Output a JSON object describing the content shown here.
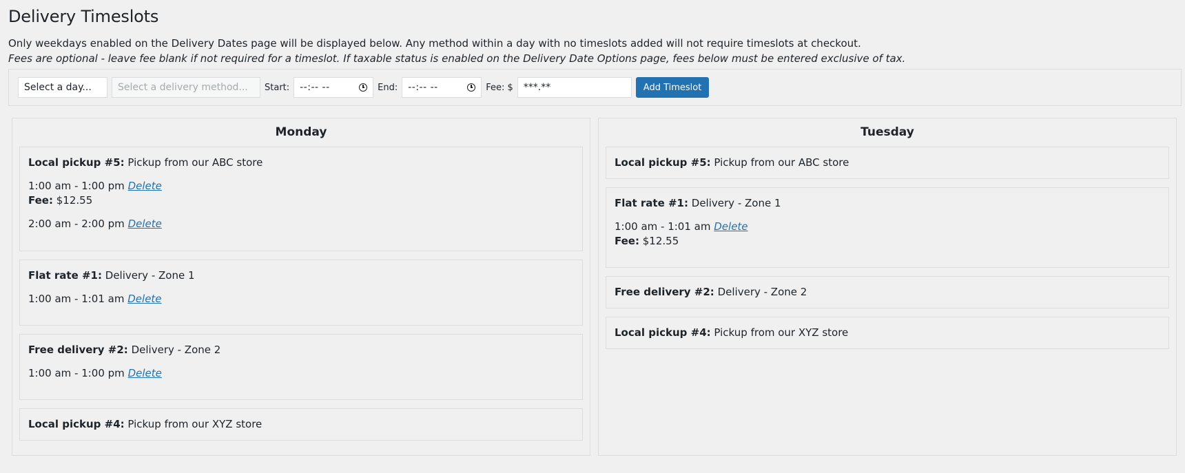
{
  "page": {
    "title": "Delivery Timeslots",
    "note1": "Only weekdays enabled on the Delivery Dates page will be displayed below. Any method within a day with no timeslots added will not require timeslots at checkout.",
    "note2": "Fees are optional - leave fee blank if not required for a timeslot. If taxable status is enabled on the Delivery Date Options page, fees below must be entered exclusive of tax."
  },
  "toolbar": {
    "day_select": "Select a day...",
    "method_select": "Select a delivery method...",
    "start_label": "Start:",
    "start_value": "--:-- --",
    "end_label": "End:",
    "end_value": "--:-- --",
    "fee_label": "Fee: $",
    "fee_placeholder": "***.**",
    "add_button": "Add Timeslot"
  },
  "days": {
    "monday": {
      "name": "Monday",
      "methods": [
        {
          "label": "Local pickup #5:",
          "desc": "Pickup from our ABC store",
          "slots": [
            {
              "time": "1:00 am - 1:00 pm",
              "delete": "Delete",
              "fee_label": "Fee:",
              "fee": "$12.55"
            },
            {
              "time": "2:00 am - 2:00 pm",
              "delete": "Delete"
            }
          ]
        },
        {
          "label": "Flat rate #1:",
          "desc": "Delivery - Zone 1",
          "slots": [
            {
              "time": "1:00 am - 1:01 am",
              "delete": "Delete"
            }
          ]
        },
        {
          "label": "Free delivery #2:",
          "desc": "Delivery - Zone 2",
          "slots": [
            {
              "time": "1:00 am - 1:00 pm",
              "delete": "Delete"
            }
          ]
        },
        {
          "label": "Local pickup #4:",
          "desc": "Pickup from our XYZ store"
        }
      ]
    },
    "tuesday": {
      "name": "Tuesday",
      "methods": [
        {
          "label": "Local pickup #5:",
          "desc": "Pickup from our ABC store"
        },
        {
          "label": "Flat rate #1:",
          "desc": "Delivery - Zone 1",
          "slots": [
            {
              "time": "1:00 am - 1:01 am",
              "delete": "Delete",
              "fee_label": "Fee:",
              "fee": "$12.55"
            }
          ]
        },
        {
          "label": "Free delivery #2:",
          "desc": "Delivery - Zone 2"
        },
        {
          "label": "Local pickup #4:",
          "desc": "Pickup from our XYZ store"
        }
      ]
    }
  }
}
